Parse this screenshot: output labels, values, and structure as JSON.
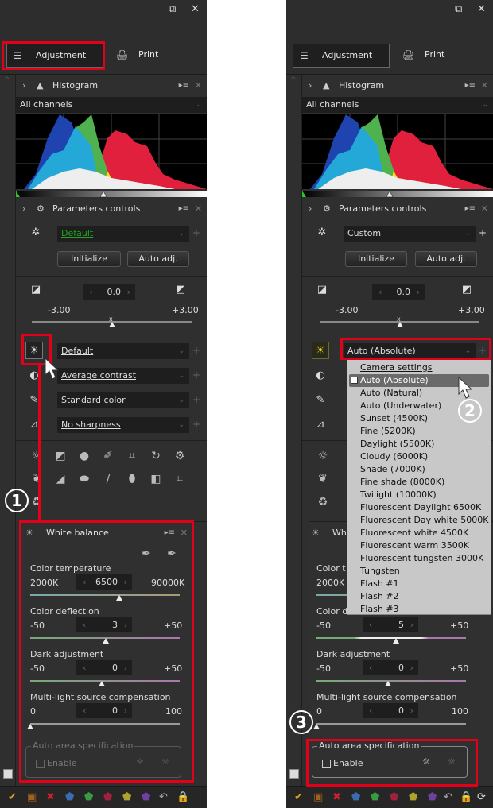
{
  "window_controls": {
    "minimize": "_",
    "restore": "⧉",
    "close": "✕"
  },
  "tabs": {
    "adjustment": "Adjustment",
    "print": "Print"
  },
  "histogram": {
    "title": "Histogram",
    "channel": "All channels"
  },
  "parameters": {
    "title": "Parameters controls",
    "initialize": "Initialize",
    "auto_adj": "Auto adj."
  },
  "exposure": {
    "value": "0.0",
    "min": "-3.00",
    "max": "+3.00",
    "position": 0.5
  },
  "left": {
    "preset": "Default",
    "wb_select": "Default",
    "contrast_select": "Average contrast",
    "color_select": "Standard color",
    "sharpness_select": "No sharpness",
    "white_balance": {
      "title": "White balance",
      "color_temperature": {
        "label": "Color temperature",
        "min": "2000K",
        "max": "90000K",
        "value": "6500"
      },
      "color_deflection": {
        "label": "Color deflection",
        "min": "-50",
        "max": "+50",
        "value": "3"
      },
      "dark_adjustment": {
        "label": "Dark adjustment",
        "min": "-50",
        "max": "+50",
        "value": "0"
      },
      "multi_light": {
        "label": "Multi-light source compensation",
        "min": "0",
        "max": "100",
        "value": "0"
      },
      "auto_area": {
        "legend": "Auto area specification",
        "enable": "Enable"
      }
    }
  },
  "right": {
    "preset": "Custom",
    "wb_select": "Auto (Absolute)",
    "white_balance": {
      "title": "Wh",
      "color_temperature": {
        "label": "Color t",
        "min": "2000K"
      },
      "color_deflection": {
        "label": "Color deflection",
        "min": "-50",
        "max": "+50",
        "value": "5"
      },
      "dark_adjustment": {
        "label": "Dark adjustment",
        "min": "-50",
        "max": "+50",
        "value": "0"
      },
      "multi_light": {
        "label": "Multi-light source compensation",
        "min": "0",
        "max": "100",
        "value": "0"
      },
      "auto_area": {
        "legend": "Auto area specification",
        "enable": "Enable"
      }
    },
    "dropdown": {
      "items": [
        "Camera settings",
        "Auto (Absolute)",
        "Auto (Natural)",
        "Auto (Underwater)",
        "Sunset (4500K)",
        "Fine (5200K)",
        "Daylight (5500K)",
        "Cloudy (6000K)",
        "Shade (7000K)",
        "Fine shade (8000K)",
        "Twilight (10000K)",
        "Fluorescent Daylight 6500K",
        "Fluorescent Day white 5000K",
        "Fluorescent white 4500K",
        "Fluorescent warm 3500K",
        "Fluorescent tungsten 3000K",
        "Tungsten",
        "Flash #1",
        "Flash #2",
        "Flash #3"
      ],
      "selected": "Auto (Absolute)"
    }
  },
  "callouts": {
    "one": "1",
    "two": "2",
    "three": "3"
  },
  "colors": {
    "highlight": "#e3001b",
    "preset_default": "#1fa51f"
  }
}
